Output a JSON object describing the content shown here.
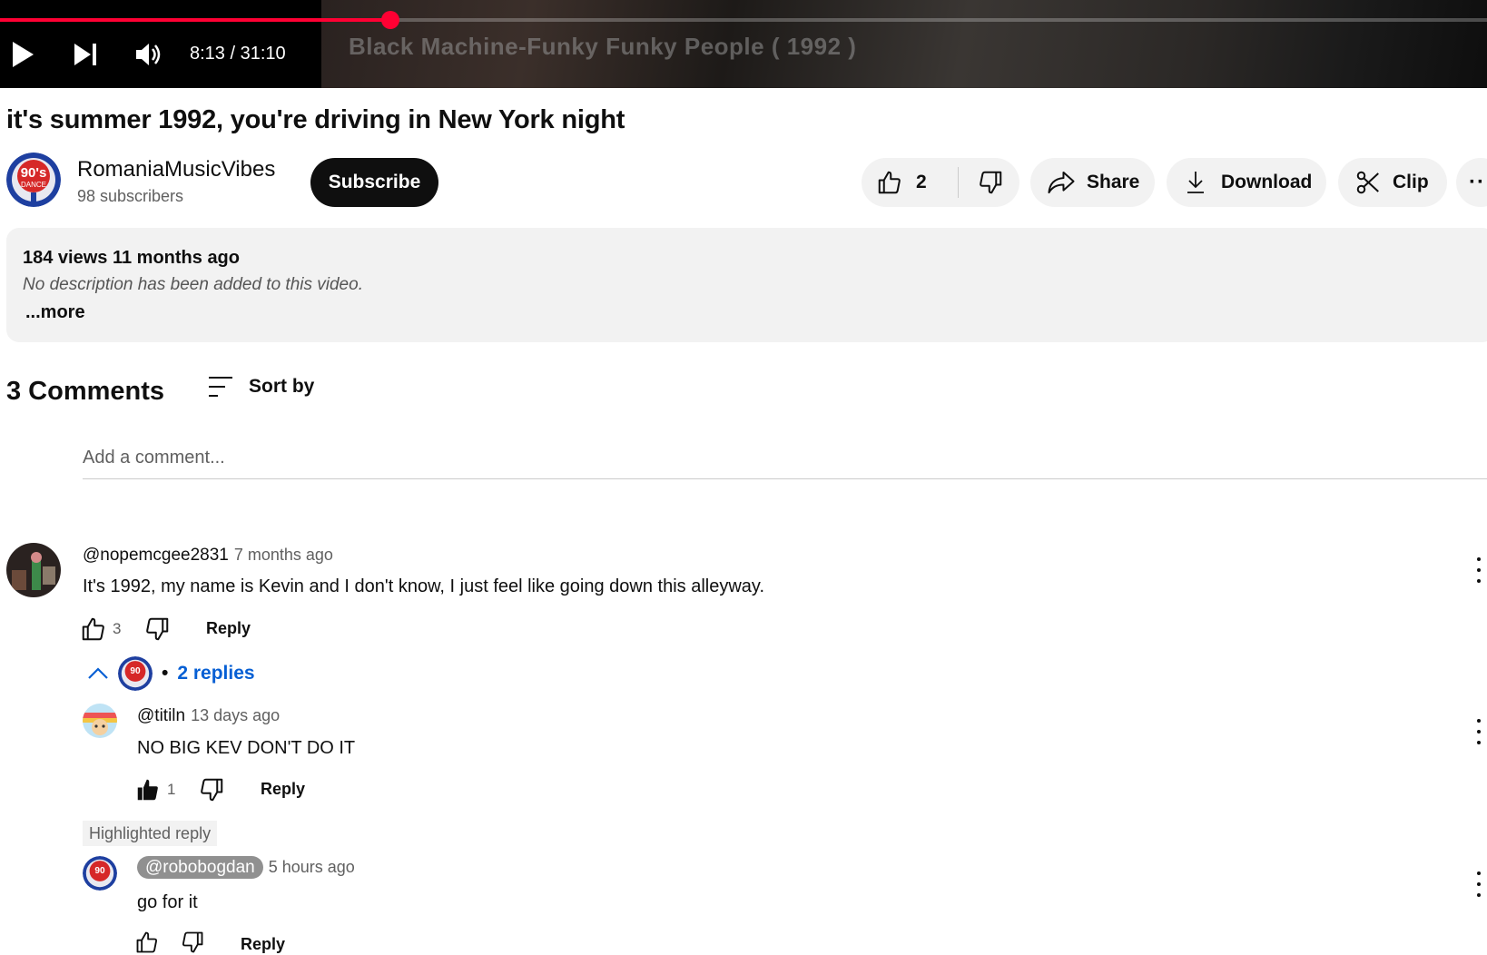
{
  "player": {
    "progress_fraction": 0.2627,
    "time": "8:13 / 31:10",
    "overlay_text": "Black Machine-Funky Funky People ( 1992 )",
    "accent": "#ff0033",
    "icons": [
      "play-icon",
      "next-icon",
      "volume-icon"
    ]
  },
  "video": {
    "title": "it's summer 1992, you're driving in New York night",
    "channel": "RomaniaMusicVibes",
    "subscribers": "98 subscribers",
    "subscribe_label": "Subscribe",
    "avatar_text": "90's DANCE",
    "likes": "2",
    "share_label": "Share",
    "download_label": "Download",
    "clip_label": "Clip"
  },
  "description": {
    "stats": "184 views  11 months ago",
    "text": "No description has been added to this video.",
    "more": "...more"
  },
  "comments": {
    "count_label": "3 Comments",
    "sort_label": "Sort by",
    "add_placeholder": "Add a comment...",
    "reply_label": "Reply",
    "items": [
      {
        "handle": "@nopemcgee2831",
        "ago": "7 months ago",
        "text": "It's 1992, my name is Kevin and I don't know, I just feel like going down this alleyway.",
        "likes": "3"
      }
    ],
    "replies_toggle": "2 replies",
    "replies_separator": "•",
    "replies": [
      {
        "handle": "@titiln",
        "ago": "13 days ago",
        "text": "NO BIG KEV DON'T DO IT",
        "likes": "1"
      },
      {
        "badge": "Highlighted reply",
        "handle": "@robobogdan",
        "ago": "5 hours ago",
        "text": "go for it"
      }
    ]
  }
}
